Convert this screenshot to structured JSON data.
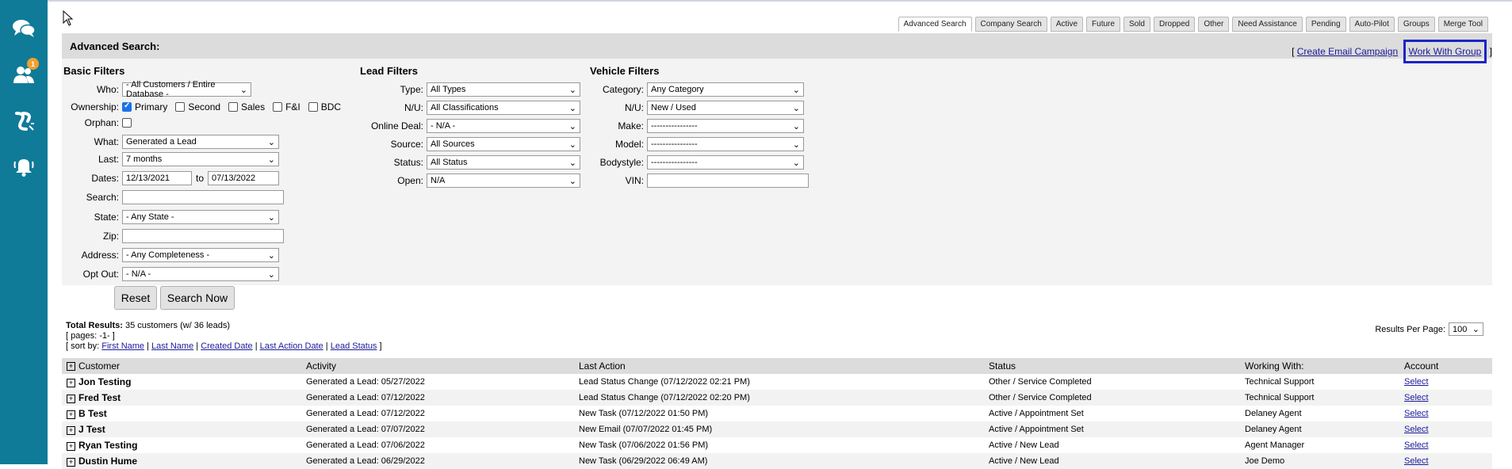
{
  "sidebar": {
    "badge_count": "1",
    "icons": [
      "chat-icon",
      "users-icon",
      "link-icon",
      "bell-icon"
    ]
  },
  "tabs": [
    "Advanced Search",
    "Company Search",
    "Active",
    "Future",
    "Sold",
    "Dropped",
    "Other",
    "Need Assistance",
    "Pending",
    "Auto-Pilot",
    "Groups",
    "Merge Tool"
  ],
  "panel": {
    "title": "Advanced Search:",
    "link_open": "[",
    "create_email": "Create Email Campaign",
    "work_with_group": "Work With Group",
    "link_close": "]"
  },
  "basic": {
    "title": "Basic Filters",
    "who_label": "Who:",
    "who_value": "- All Customers / Entire Database -",
    "ownership_label": "Ownership:",
    "owners": [
      {
        "label": "Primary",
        "checked": true
      },
      {
        "label": "Second",
        "checked": false
      },
      {
        "label": "Sales",
        "checked": false
      },
      {
        "label": "F&I",
        "checked": false
      },
      {
        "label": "BDC",
        "checked": false
      }
    ],
    "orphan_label": "Orphan:",
    "what_label": "What:",
    "what_value": "Generated a Lead",
    "last_label": "Last:",
    "last_value": "7 months",
    "dates_label": "Dates:",
    "date_from": "12/13/2021",
    "date_to_label": "to",
    "date_to": "07/13/2022",
    "search_label": "Search:",
    "state_label": "State:",
    "state_value": "- Any State -",
    "zip_label": "Zip:",
    "address_label": "Address:",
    "address_value": "- Any Completeness -",
    "optout_label": "Opt Out:",
    "optout_value": "- N/A -",
    "reset": "Reset",
    "search_now": "Search Now"
  },
  "lead": {
    "title": "Lead Filters",
    "type_label": "Type:",
    "type_value": "All Types",
    "nu_label": "N/U:",
    "nu_value": "All Classifications",
    "deal_label": "Online Deal:",
    "deal_value": "- N/A -",
    "source_label": "Source:",
    "source_value": "All Sources",
    "status_label": "Status:",
    "status_value": "All Status",
    "open_label": "Open:",
    "open_value": "N/A"
  },
  "vehicle": {
    "title": "Vehicle Filters",
    "category_label": "Category:",
    "category_value": "Any Category",
    "nu_label": "N/U:",
    "nu_value": "New / Used",
    "make_label": "Make:",
    "make_value": "----------------",
    "model_label": "Model:",
    "model_value": "----------------",
    "body_label": "Bodystyle:",
    "body_value": "----------------",
    "vin_label": "VIN:"
  },
  "results": {
    "total_label": "Total Results:",
    "total_text": "35 customers (w/ 36 leads)",
    "pages": "[ pages: -1- ]",
    "sort_prefix": "[ sort by:",
    "sort_links": [
      "First Name",
      "Last Name",
      "Created Date",
      "Last Action Date",
      "Lead Status"
    ],
    "sort_suffix": "]",
    "per_page_label": "Results Per Page:",
    "per_page_value": "100"
  },
  "table": {
    "headers": [
      "Customer",
      "Activity",
      "Last Action",
      "Status",
      "Working With:",
      "Account"
    ],
    "rows": [
      {
        "name": "Jon Testing",
        "activity": "Generated a Lead: 05/27/2022",
        "last": "Lead Status Change (07/12/2022 02:21 PM)",
        "status": "Other / Service Completed",
        "with": "Technical Support",
        "account": "Select"
      },
      {
        "name": "Fred Test",
        "activity": "Generated a Lead: 07/12/2022",
        "last": "Lead Status Change (07/12/2022 02:20 PM)",
        "status": "Other / Service Completed",
        "with": "Technical Support",
        "account": "Select"
      },
      {
        "name": "B Test",
        "activity": "Generated a Lead: 07/12/2022",
        "last": "New Task (07/12/2022 01:50 PM)",
        "status": "Active / Appointment Set",
        "with": "Delaney Agent",
        "account": "Select"
      },
      {
        "name": "J Test",
        "activity": "Generated a Lead: 07/07/2022",
        "last": "New Email (07/07/2022 01:45 PM)",
        "status": "Active / Appointment Set",
        "with": "Delaney Agent",
        "account": "Select"
      },
      {
        "name": "Ryan Testing",
        "activity": "Generated a Lead: 07/06/2022",
        "last": "New Task (07/06/2022 01:56 PM)",
        "status": "Active / New Lead",
        "with": "Agent Manager",
        "account": "Select"
      },
      {
        "name": "Dustin Hume",
        "activity": "Generated a Lead: 06/29/2022",
        "last": "New Task (06/29/2022 06:49 AM)",
        "status": "Active / New Lead",
        "with": "Joe Demo",
        "account": "Select"
      }
    ]
  }
}
